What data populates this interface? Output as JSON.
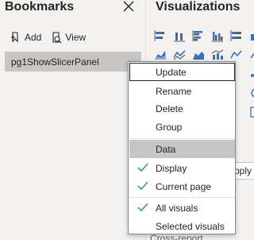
{
  "bookmarks": {
    "title": "Bookmarks",
    "add_label": "Add",
    "view_label": "View",
    "items": [
      {
        "label": "pg1ShowSlicerPanel",
        "more": "..."
      }
    ]
  },
  "visualizations": {
    "title": "Visualizations",
    "icons": [
      "stacked-bar-chart-icon",
      "stacked-column-chart-icon",
      "clustered-bar-chart-icon",
      "clustered-column-chart-icon",
      "100-stacked-bar-chart-icon",
      "100-stacked-column-chart-icon",
      "area-chart-icon",
      "line-chart-icon",
      "stacked-area-chart-icon",
      "line-and-column-chart-icon",
      "ribbon-chart-icon",
      "waterfall-chart-icon"
    ],
    "tail_text": "Cross-report"
  },
  "tooltip": {
    "text": "Apply t"
  },
  "context_menu": {
    "items": [
      {
        "label": "Update",
        "focused": true
      },
      {
        "label": "Rename"
      },
      {
        "label": "Delete"
      },
      {
        "label": "Group"
      },
      {
        "label": "Data",
        "selected": true
      },
      {
        "label": "Display",
        "checked": true
      },
      {
        "label": "Current page",
        "checked": true
      },
      {
        "label": "All visuals",
        "checked": true
      },
      {
        "label": "Selected visuals"
      }
    ]
  },
  "colors": {
    "pane_bg": "#f3f2f1",
    "selected_bg": "#c8c6c4",
    "check_green": "#3f9e5b",
    "viz_blue": "#3b6fb6",
    "text": "#252423"
  }
}
